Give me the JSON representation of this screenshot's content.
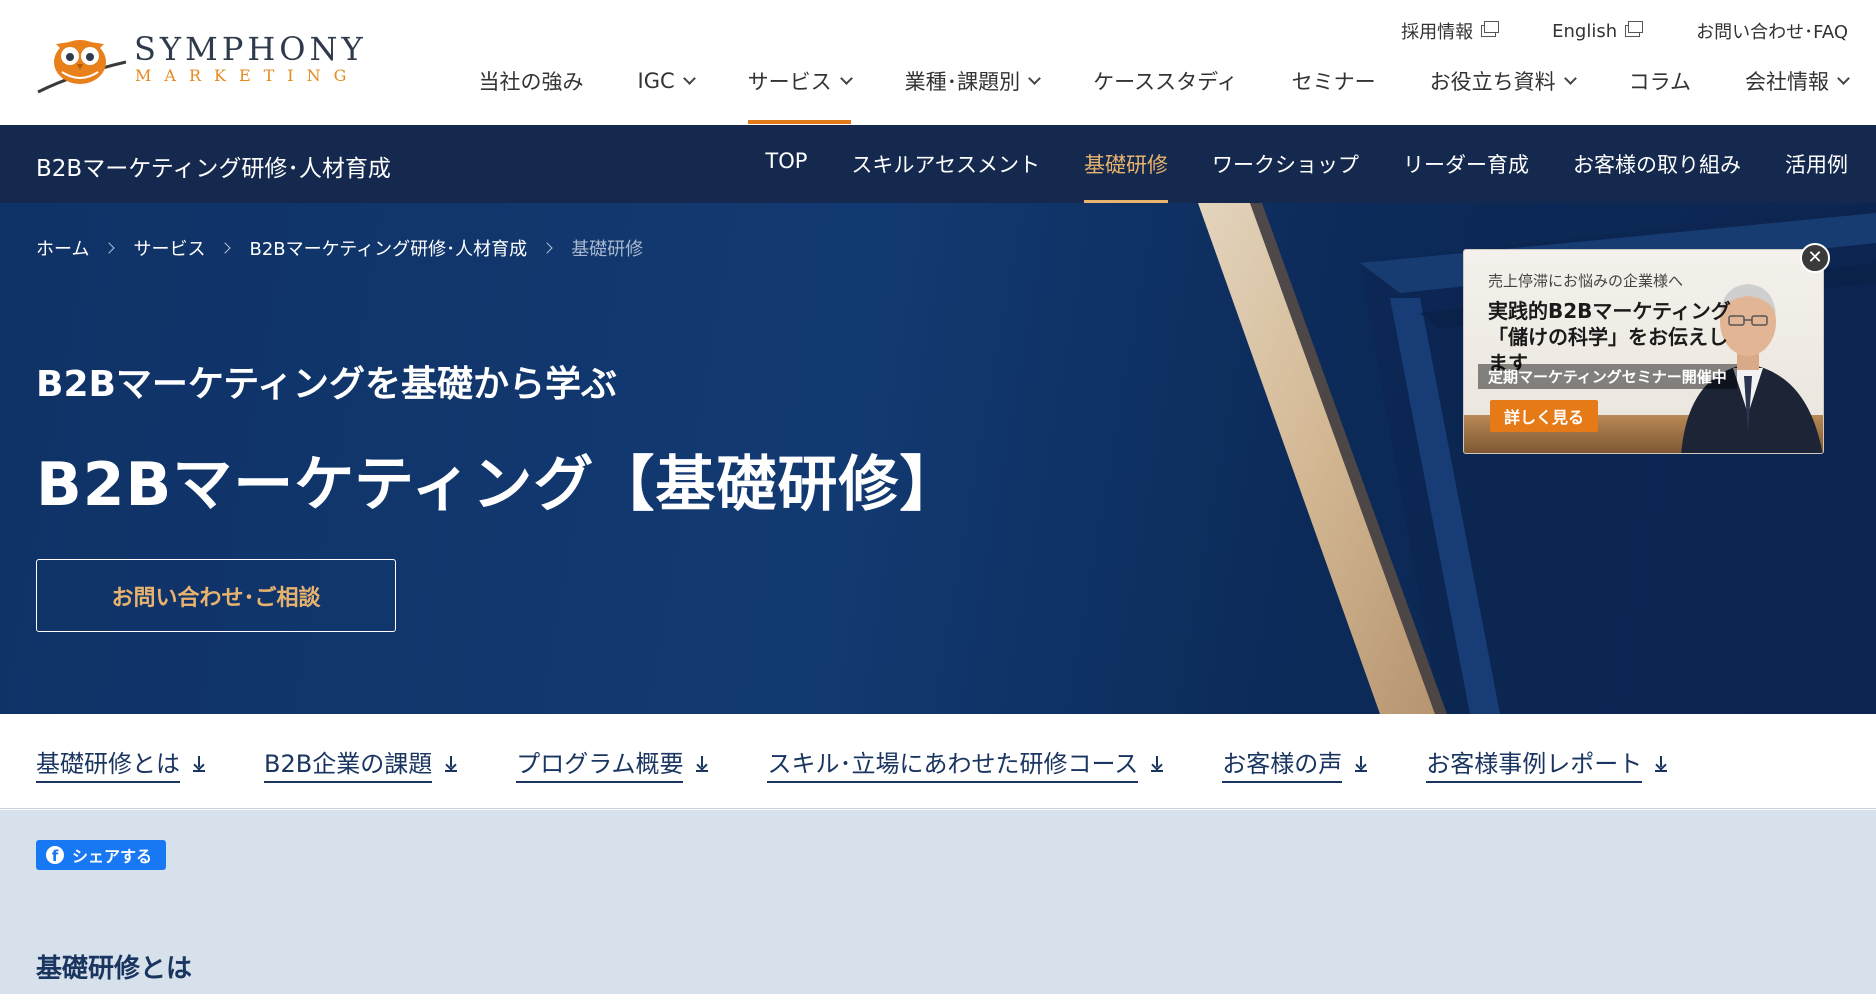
{
  "brand": {
    "name": "SYMPHONY",
    "sub": "MARKETING"
  },
  "utility": [
    {
      "label": "採用情報",
      "icon": "external-link-icon"
    },
    {
      "label": "English",
      "icon": "external-link-icon"
    },
    {
      "label": "お問い合わせ･FAQ"
    }
  ],
  "global_nav": [
    {
      "label": "当社の強み",
      "dropdown": false
    },
    {
      "label": "IGC",
      "dropdown": true
    },
    {
      "label": "サービス",
      "dropdown": true,
      "active": true
    },
    {
      "label": "業種･課題別",
      "dropdown": true
    },
    {
      "label": "ケーススタディ",
      "dropdown": false
    },
    {
      "label": "セミナー",
      "dropdown": false
    },
    {
      "label": "お役立ち資料",
      "dropdown": true
    },
    {
      "label": "コラム",
      "dropdown": false
    },
    {
      "label": "会社情報",
      "dropdown": true
    }
  ],
  "subnav": {
    "title": "B2Bマーケティング研修･人材育成",
    "items": [
      "TOP",
      "スキルアセスメント",
      "基礎研修",
      "ワークショップ",
      "リーダー育成",
      "お客様の取り組み",
      "活用例"
    ],
    "active_index": 2
  },
  "breadcrumb": [
    "ホーム",
    "サービス",
    "B2Bマーケティング研修･人材育成",
    "基礎研修"
  ],
  "hero": {
    "subtitle": "B2Bマーケティングを基礎から学ぶ",
    "title": "B2Bマーケティング【基礎研修】",
    "cta": "お問い合わせ･ご相談"
  },
  "popup": {
    "line1": "売上停滞にお悩みの企業様へ",
    "line2": "実践的B2Bマーケティング「儲けの科学」をお伝えします",
    "line3": "定期マーケティングセミナー開催中",
    "button": "詳しく見る",
    "close": "✕"
  },
  "anchors": [
    "基礎研修とは",
    "B2B企業の課題",
    "プログラム概要",
    "スキル･立場にあわせた研修コース",
    "お客様の声",
    "お客様事例レポート"
  ],
  "share": {
    "label": "シェアする",
    "icon_glyph": "f"
  },
  "section": {
    "title": "基礎研修とは"
  },
  "colors": {
    "navy": "#14294d",
    "accent": "#e07a1a",
    "gold": "#e8b36e",
    "facebook": "#1877f2"
  }
}
